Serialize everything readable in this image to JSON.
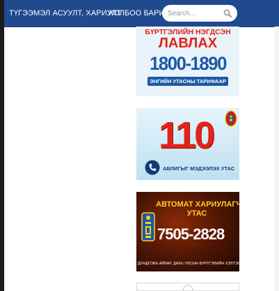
{
  "navbar": {
    "links": [
      {
        "label": "ТҮГЭЭМЭЛ АСУУЛТ, ХАРИУЛТ"
      },
      {
        "label": "ХОЛБОО БАРИХ"
      }
    ],
    "search": {
      "placeholder": "Search..."
    }
  },
  "banners": [
    {
      "line1": "БҮРТГЭЛИЙН НЭГДСЭН",
      "line2": "ЛАВЛАХ",
      "number": "1800-1890",
      "footer": "ЭНГИЙН УТАСНЫ ТАРИФААР"
    },
    {
      "number": "110",
      "label": "АВЛИГЫГ МЭДЭЭЛЭХ УТАС"
    },
    {
      "line1": "АВТОМАТ ХАРИУЛАГЧ",
      "line2": "УТАС",
      "number": "7505-2828",
      "footer": "ДУНДГОВЬ АЙМАГ ДАХЬ УЛСЫН БҮРТГЭЛИЙН ХЭЛТЭС"
    }
  ],
  "colors": {
    "nav_bg": "#1f4a8e",
    "accent_red": "#e2231a",
    "accent_blue": "#1b5aa6",
    "accent_yellow": "#ffd21a"
  },
  "icons": {
    "search": "search-icon",
    "phone": "phone-icon",
    "emblem": "soyombo-emblem-icon"
  }
}
